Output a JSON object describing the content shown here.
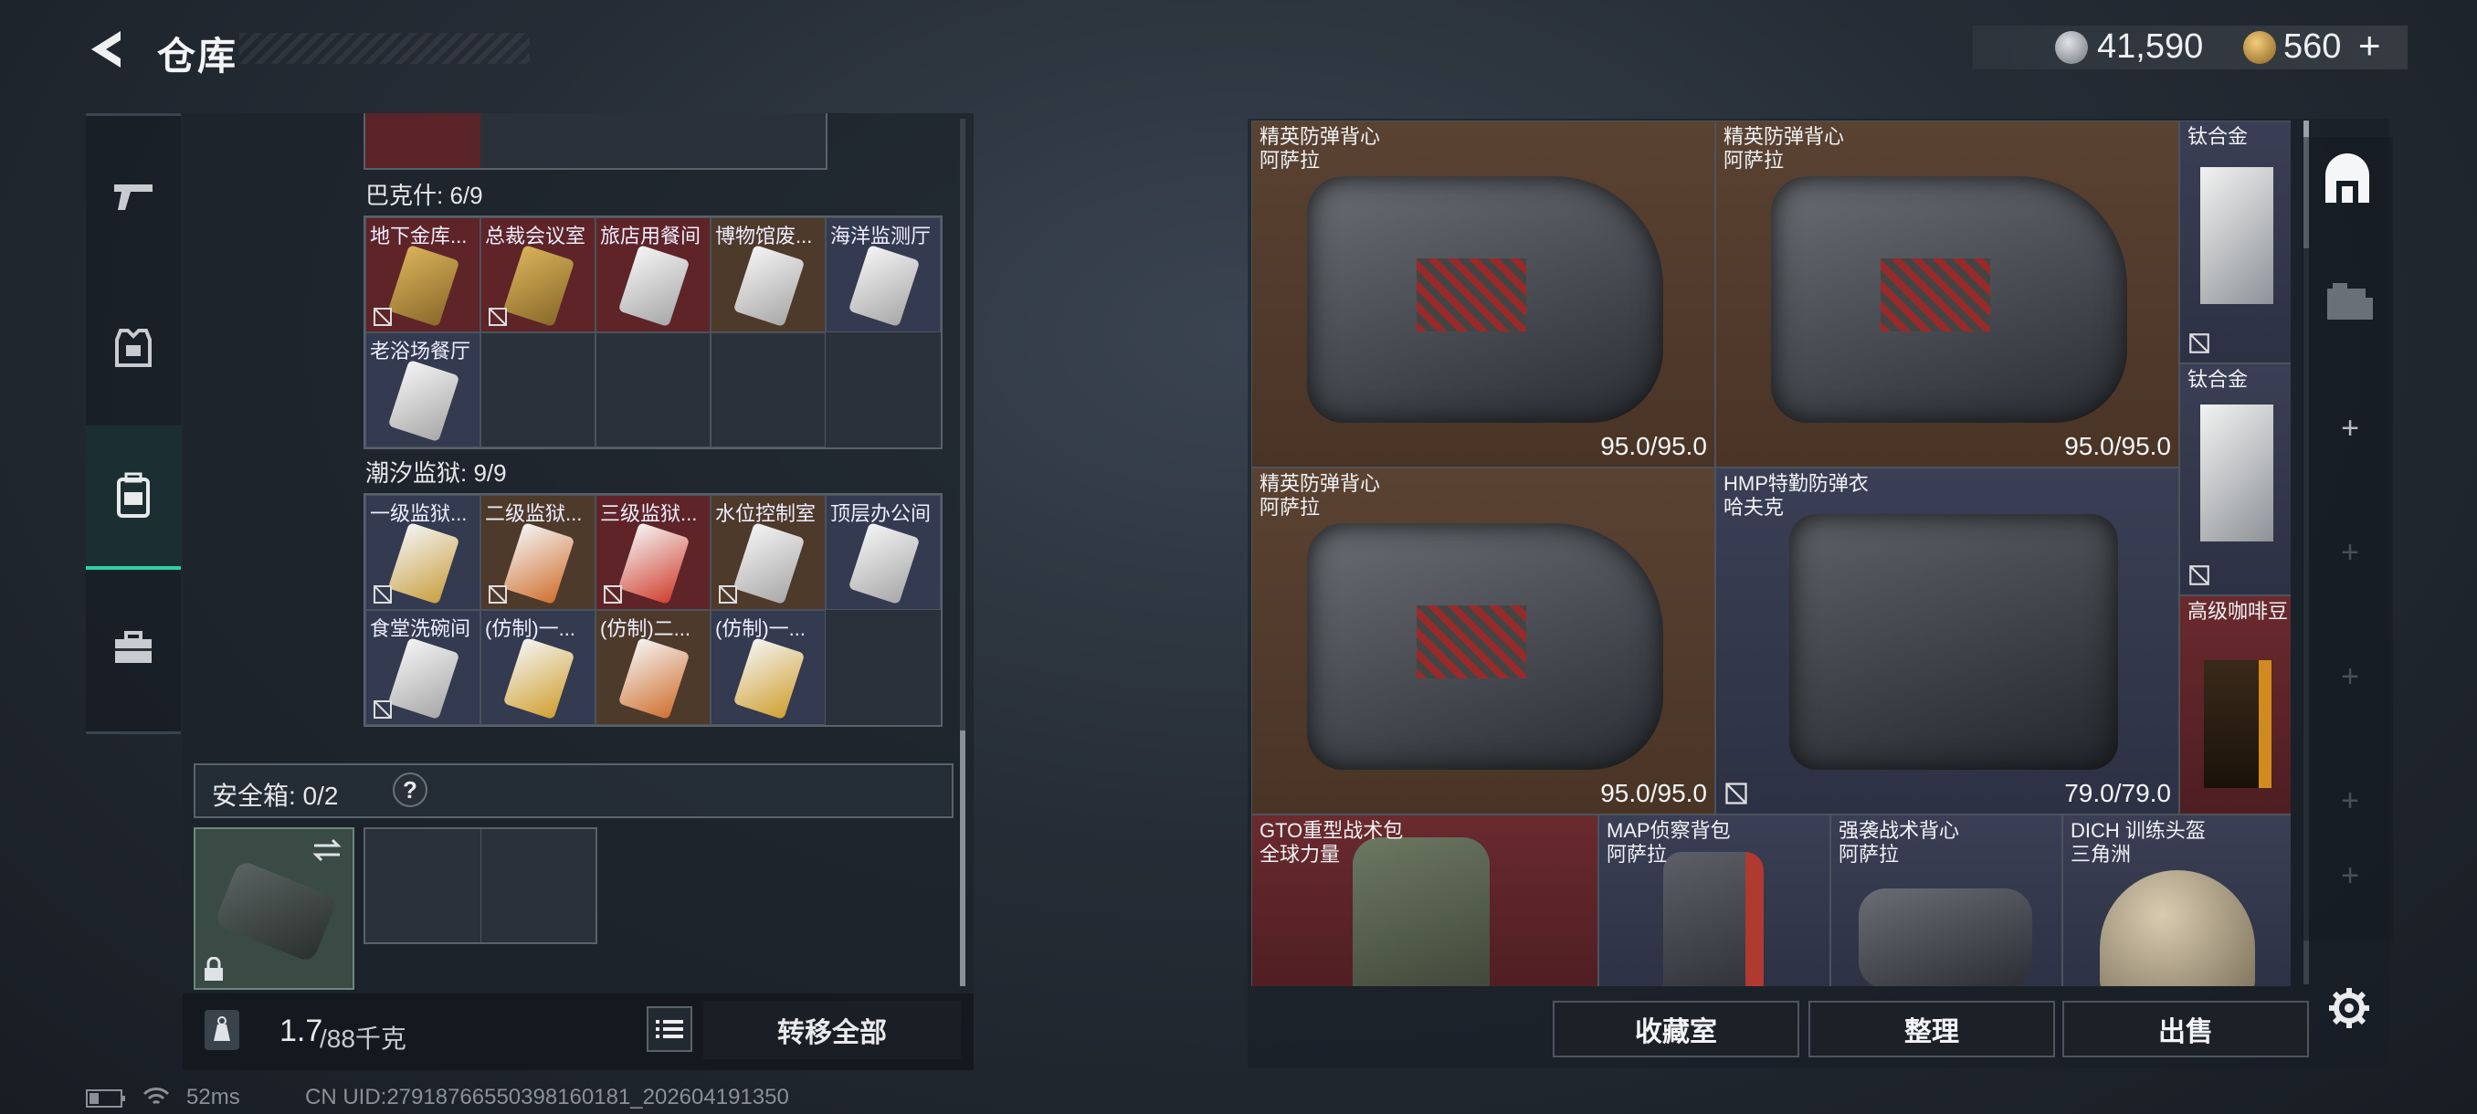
{
  "header": {
    "title": "仓库",
    "currency1": "41,590",
    "currency2": "560",
    "add_label": "+"
  },
  "nav": {
    "items": [
      {
        "icon": "pistol-icon"
      },
      {
        "icon": "armor-icon"
      },
      {
        "icon": "backpack-icon"
      },
      {
        "icon": "briefcase-icon"
      }
    ]
  },
  "left": {
    "section1": {
      "label": "巴克什: 6/9",
      "cells": [
        "地下金库...",
        "总裁会议室",
        "旅店用餐间",
        "博物馆废...",
        "海洋监测厅",
        "老浴场餐厅"
      ]
    },
    "section2": {
      "label": "潮汐监狱: 9/9",
      "cells": [
        "一级监狱...",
        "二级监狱...",
        "三级监狱...",
        "水位控制室",
        "顶层办公间",
        "食堂洗碗间",
        "(仿制)一...",
        "(仿制)二...",
        "(仿制)一..."
      ]
    },
    "safebox": {
      "label": "安全箱: 0/2",
      "help": "?"
    },
    "weight": {
      "current": "1.7",
      "max": "/88千克"
    },
    "transfer_all": "转移全部"
  },
  "right": {
    "items": [
      {
        "name": "精英防弹背心",
        "sub": "阿萨拉",
        "dur": "95.0/95.0"
      },
      {
        "name": "精英防弹背心",
        "sub": "阿萨拉",
        "dur": "95.0/95.0"
      },
      {
        "name": "钛合金",
        "sub": ""
      },
      {
        "name": "钛合金",
        "sub": ""
      },
      {
        "name": "精英防弹背心",
        "sub": "阿萨拉",
        "dur": "95.0/95.0"
      },
      {
        "name": "HMP特勤防弹衣",
        "sub": "哈夫克",
        "dur": "79.0/79.0"
      },
      {
        "name": "高级咖啡豆",
        "sub": ""
      },
      {
        "name": "GTO重型战术包",
        "sub": "全球力量"
      },
      {
        "name": "MAP侦察背包",
        "sub": "阿萨拉"
      },
      {
        "name": "强袭战术背心",
        "sub": "阿萨拉"
      },
      {
        "name": "DICH 训练头盔",
        "sub": "三角洲"
      }
    ],
    "buttons": {
      "collection": "收藏室",
      "sort": "整理",
      "sell": "出售"
    }
  },
  "status": {
    "ping": "52ms",
    "uid": "CN UID:27918766550398160181_202604191350"
  }
}
